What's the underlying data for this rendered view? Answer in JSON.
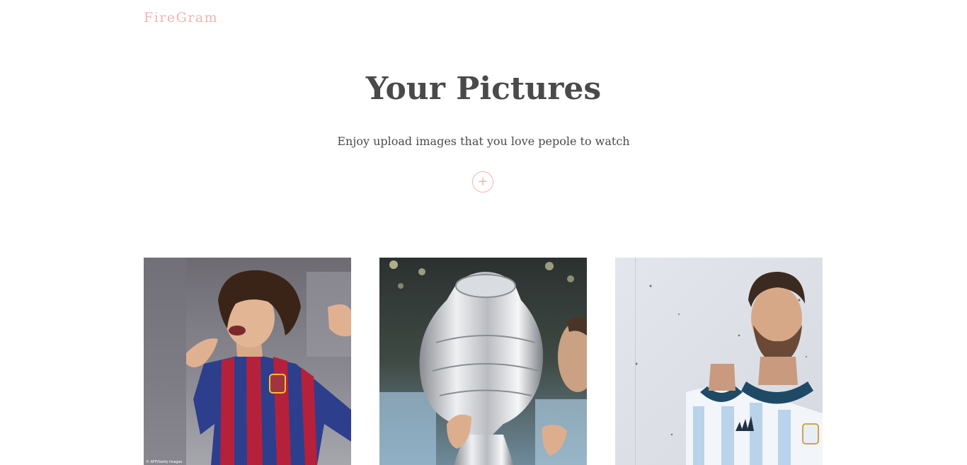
{
  "header": {
    "logo": "FireGram"
  },
  "main": {
    "title": "Your Pictures",
    "subtitle": "Enjoy upload images that you love pepole to watch",
    "upload_symbol": "+"
  },
  "gallery": {
    "images": [
      {
        "alt": "player-celebrating-photo",
        "credit": "© AFP/Getty Images"
      },
      {
        "alt": "player-kissing-trophy-photo",
        "credit": ""
      },
      {
        "alt": "player-portrait-photo",
        "credit": ""
      }
    ]
  },
  "colors": {
    "accent": "#efb6b2",
    "text": "#4a4a4a",
    "background": "#ffffff"
  }
}
